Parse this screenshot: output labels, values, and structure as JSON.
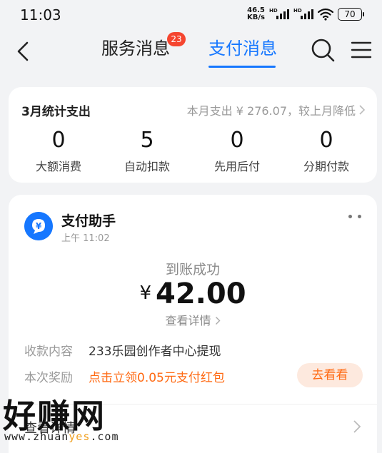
{
  "status_bar": {
    "time": "11:03",
    "net_speed_value": "46.5",
    "net_speed_unit": "KB/s",
    "hd_label": "HD",
    "battery": "70"
  },
  "header": {
    "tab_service": "服务消息",
    "tab_service_badge": "23",
    "tab_payment": "支付消息",
    "active_tab": "支付消息",
    "accent_color": "#1677ff"
  },
  "stats": {
    "title": "3月统计支出",
    "summary": "本月支出 ¥ 276.07，较上月降低",
    "items": [
      {
        "value": "0",
        "label": "大额消费"
      },
      {
        "value": "5",
        "label": "自动扣款"
      },
      {
        "value": "0",
        "label": "先用后付"
      },
      {
        "value": "0",
        "label": "分期付款"
      }
    ]
  },
  "message": {
    "sender": "支付助手",
    "time": "上午 11:02",
    "status": "到账成功",
    "currency": "¥",
    "amount": "42.00",
    "detail_link": "查看详情",
    "content_label": "收款内容",
    "content_value": "233乐园创作者中心提现",
    "reward_label": "本次奖励",
    "reward_value": "点击立领0.05元支付红包",
    "reward_color": "#ff6a13",
    "go_button": "去看看",
    "footer_link": "查看详情"
  },
  "watermark": {
    "main": "好赚网",
    "url_prefix": "www.zhuan",
    "url_accent": "yes",
    "url_suffix": ".com"
  },
  "icons": [
    "back-icon",
    "search-icon",
    "menu-icon",
    "wifi-icon",
    "more-icon",
    "chevron-right-icon",
    "assistant-icon"
  ]
}
